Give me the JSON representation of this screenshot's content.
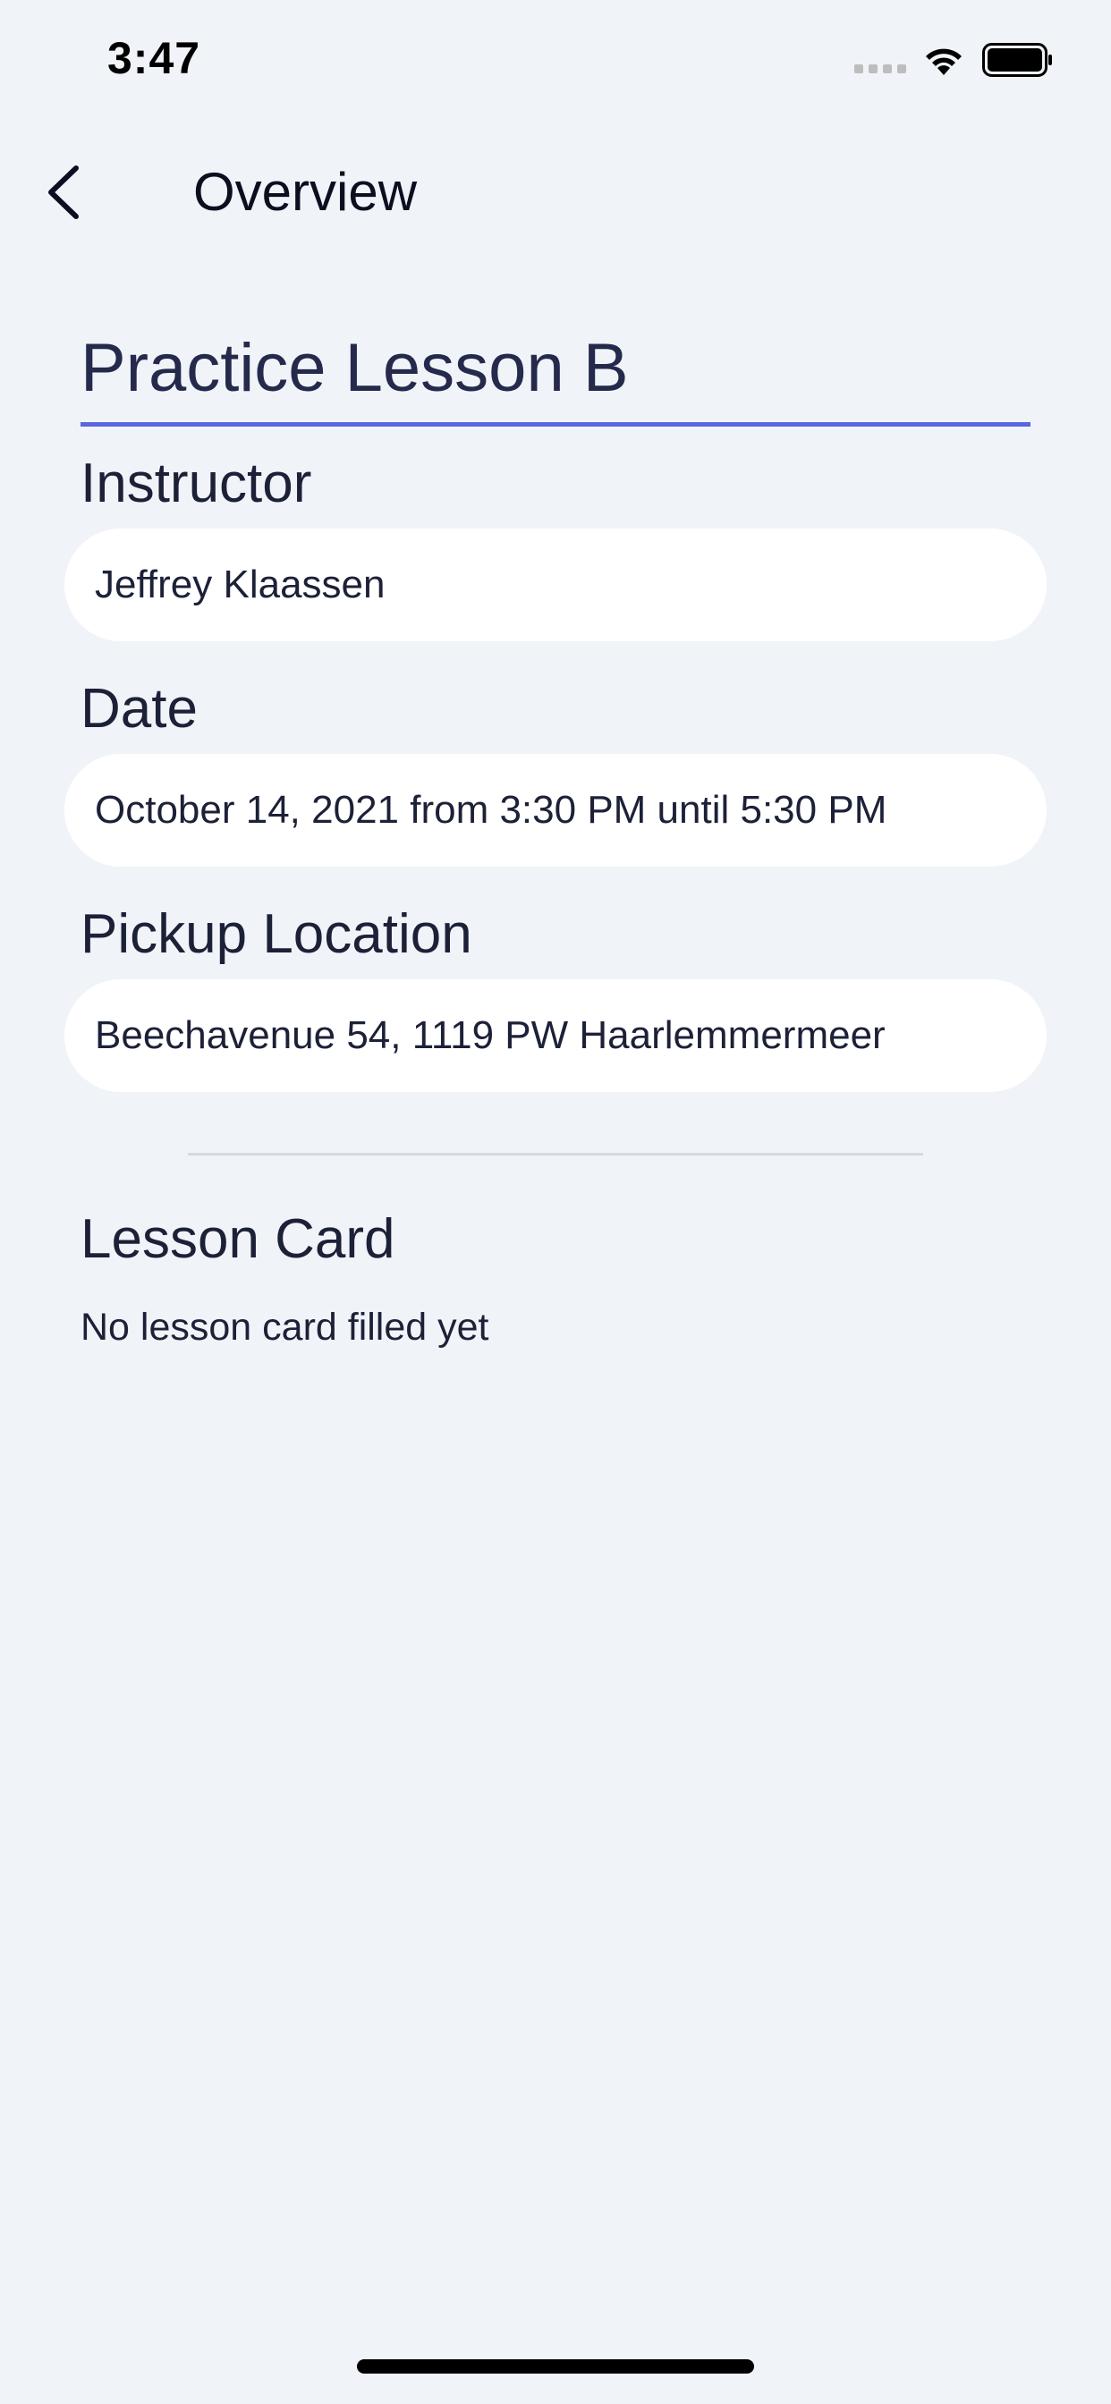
{
  "status_bar": {
    "time": "3:47",
    "icons": [
      "signal-dots-icon",
      "wifi-icon",
      "battery-icon"
    ]
  },
  "header": {
    "back_icon": "chevron-left-icon",
    "title": "Overview"
  },
  "lesson": {
    "title_value": "Practice Lesson B"
  },
  "instructor": {
    "label": "Instructor",
    "value": "Jeffrey Klaassen"
  },
  "date": {
    "label": "Date",
    "value": "October 14, 2021 from 3:30 PM until 5:30 PM"
  },
  "pickup": {
    "label": "Pickup Location",
    "value": "Beechavenue 54, 1119 PW Haarlemmermeer"
  },
  "lesson_card": {
    "heading": "Lesson Card",
    "text": "No lesson card filled yet"
  },
  "colors": {
    "background": "#f0f4f8",
    "accent": "#5866e0",
    "text": "#1c2138",
    "field_background": "#ffffff"
  }
}
